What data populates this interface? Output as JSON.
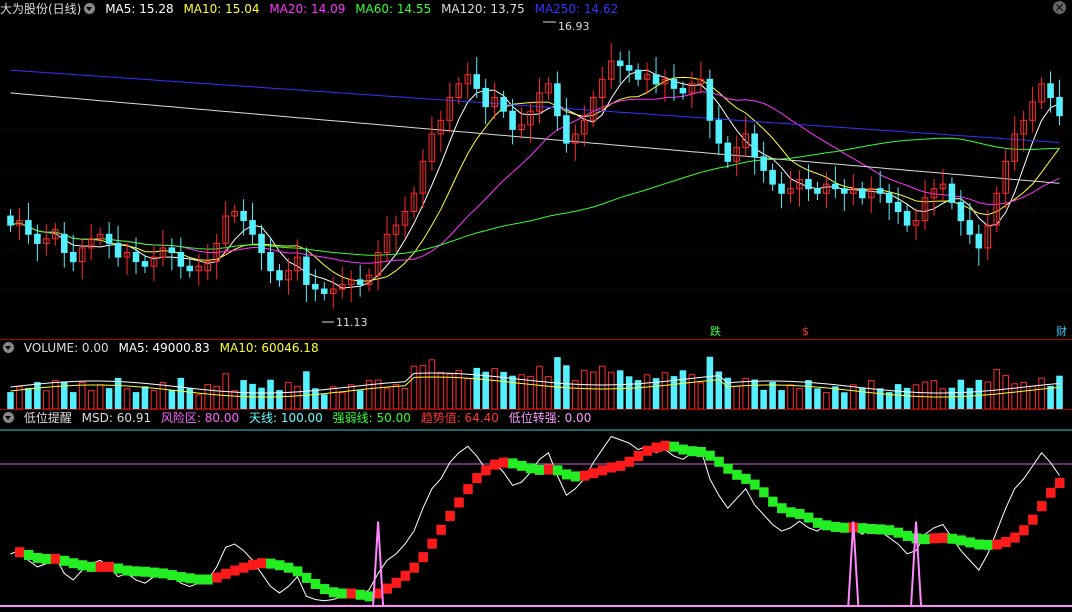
{
  "colors": {
    "up": "#ff2a2a",
    "down": "#54f0ff",
    "ma5": "#ffffff",
    "ma10": "#ffff33",
    "ma20": "#ff33ff",
    "ma60": "#33ff33",
    "ma120": "#dcdcdc",
    "ma250": "#3333ff"
  },
  "header": {
    "title": "大为股份(日线)",
    "ma5": "MA5: 15.28",
    "ma10": "MA10: 15.04",
    "ma20": "MA20: 14.09",
    "ma60": "MA60: 14.55",
    "ma120": "MA120: 13.75",
    "ma250": "MA250: 14.62"
  },
  "volume_header": {
    "volume": "VOLUME: 0.00",
    "ma5": "MA5: 49000.83",
    "ma10": "MA10: 60046.18"
  },
  "indicator_header": {
    "title": "低位提醒",
    "msd": "MSD: 60.91",
    "risk": "风险区: 80.00",
    "sky": "天线: 100.00",
    "strength": "强弱线: 50.00",
    "trend": "趋势值: 64.40",
    "turn": "低位转强: 0.00"
  },
  "markers": {
    "high": "16.93",
    "low": "11.13",
    "die": "跌",
    "dollar": "$",
    "cai": "财"
  },
  "chart_data": [
    {
      "type": "candlestick",
      "title": "大为股份(日线)",
      "price_range": [
        10.5,
        17.3
      ],
      "ma_values": {
        "MA5": 15.28,
        "MA10": 15.04,
        "MA20": 14.09,
        "MA60": 14.55,
        "MA120": 13.75,
        "MA250": 14.62
      },
      "extremes": {
        "high": 16.93,
        "low": 11.13
      },
      "close": [
        12.8,
        12.9,
        12.6,
        12.4,
        12.5,
        12.7,
        12.2,
        12.0,
        12.3,
        12.5,
        12.6,
        12.4,
        12.1,
        12.2,
        12.0,
        11.9,
        12.1,
        12.3,
        12.2,
        11.9,
        11.8,
        11.9,
        12.0,
        12.4,
        13.0,
        13.1,
        12.9,
        12.6,
        12.2,
        11.8,
        11.6,
        11.8,
        12.1,
        11.5,
        11.4,
        11.3,
        11.4,
        11.5,
        11.6,
        11.5,
        11.7,
        12.2,
        12.6,
        12.8,
        13.1,
        13.5,
        14.2,
        14.8,
        15.1,
        15.6,
        15.9,
        16.1,
        15.8,
        15.4,
        15.6,
        15.3,
        14.9,
        15.0,
        15.3,
        15.7,
        15.9,
        15.2,
        14.6,
        14.8,
        15.1,
        15.6,
        16.0,
        16.4,
        16.3,
        16.2,
        16.0,
        16.1,
        15.9,
        16.0,
        15.8,
        15.7,
        15.9,
        16.0,
        15.1,
        14.6,
        14.2,
        14.5,
        14.8,
        14.3,
        14.0,
        13.7,
        13.5,
        13.6,
        13.8,
        13.6,
        13.5,
        13.7,
        13.6,
        13.5,
        13.6,
        13.4,
        13.6,
        13.5,
        13.3,
        13.1,
        12.8,
        12.9,
        13.4,
        13.6,
        13.7,
        13.3,
        12.9,
        12.6,
        12.3,
        12.8,
        13.5,
        14.2,
        14.8,
        15.1,
        15.5,
        15.9,
        15.6,
        15.2
      ],
      "open": [
        13.0,
        12.8,
        12.9,
        12.6,
        12.4,
        12.5,
        12.6,
        12.2,
        12.0,
        12.3,
        12.5,
        12.6,
        12.4,
        12.1,
        12.2,
        12.0,
        11.9,
        12.1,
        12.3,
        12.2,
        11.9,
        11.8,
        11.8,
        12.0,
        12.4,
        13.0,
        13.1,
        12.9,
        12.6,
        12.2,
        11.8,
        11.6,
        11.8,
        12.1,
        11.5,
        11.4,
        11.3,
        11.4,
        11.5,
        11.6,
        11.5,
        11.7,
        12.2,
        12.6,
        12.8,
        13.1,
        13.5,
        14.2,
        14.8,
        15.1,
        15.6,
        15.9,
        16.1,
        15.8,
        15.4,
        15.6,
        15.3,
        14.9,
        15.0,
        15.3,
        15.7,
        15.9,
        15.2,
        14.6,
        14.8,
        15.1,
        15.6,
        16.0,
        16.4,
        16.3,
        16.2,
        16.0,
        16.1,
        15.9,
        16.0,
        15.8,
        15.7,
        15.9,
        16.0,
        15.1,
        14.6,
        14.2,
        14.5,
        14.8,
        14.3,
        14.0,
        13.7,
        13.5,
        13.6,
        13.8,
        13.6,
        13.5,
        13.7,
        13.6,
        13.5,
        13.6,
        13.4,
        13.6,
        13.5,
        13.3,
        13.1,
        12.8,
        12.9,
        13.4,
        13.6,
        13.7,
        13.3,
        12.9,
        12.6,
        12.3,
        12.8,
        13.5,
        14.2,
        14.8,
        15.1,
        15.5,
        15.9,
        15.6
      ]
    },
    {
      "type": "bar",
      "title": "VOLUME",
      "ma_values": {
        "MA5": 49000.83,
        "MA10": 60046.18
      }
    },
    {
      "type": "line",
      "title": "低位提醒",
      "values": {
        "MSD": 60.91,
        "风险区": 80.0,
        "天线": 100.0,
        "强弱线": 50.0,
        "趋势值": 64.4,
        "低位转强": 0.0
      }
    }
  ]
}
